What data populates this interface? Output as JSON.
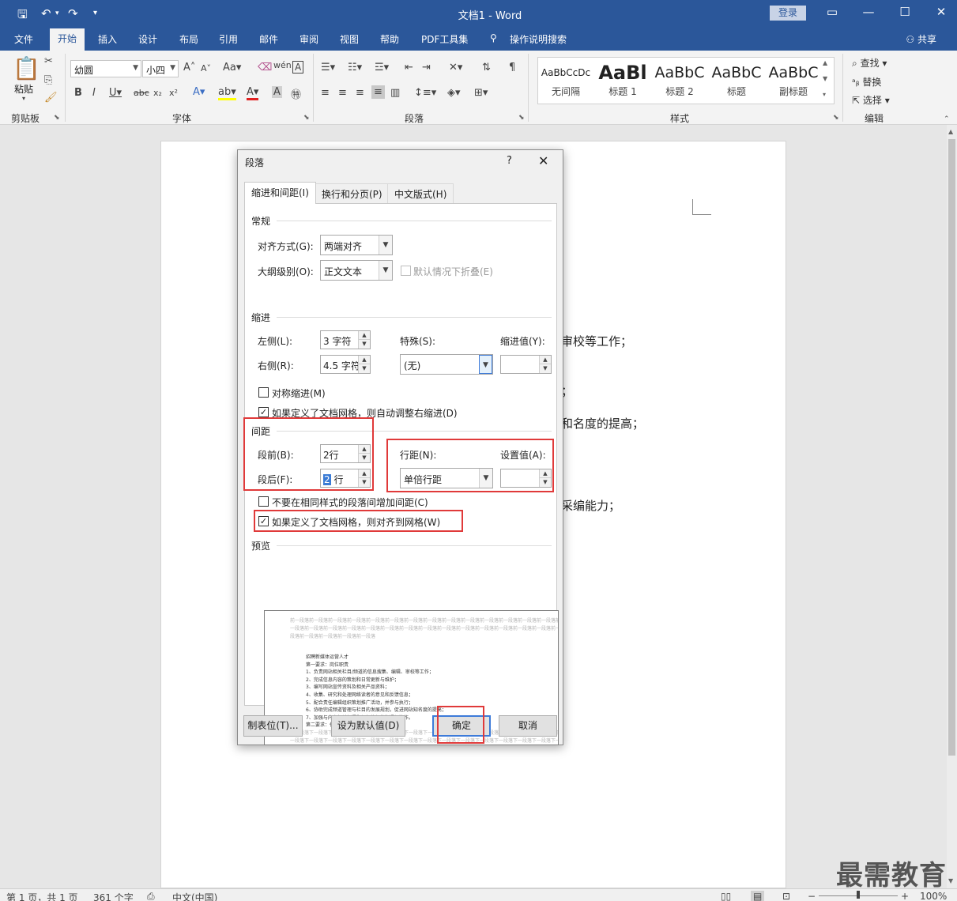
{
  "app": {
    "doc_title": "文档1 - Word",
    "login": "登录",
    "share": "共享",
    "search_tab": "操作说明搜索"
  },
  "tabs": [
    "文件",
    "开始",
    "插入",
    "设计",
    "布局",
    "引用",
    "邮件",
    "审阅",
    "视图",
    "帮助",
    "PDF工具集"
  ],
  "ribbon": {
    "clipboard": {
      "paste": "粘贴",
      "label": "剪贴板"
    },
    "font": {
      "name": "幼圆",
      "size": "小四",
      "label": "字体"
    },
    "paragraph": {
      "label": "段落"
    },
    "styles": {
      "label": "样式",
      "items": [
        {
          "sample": "AaBbCcDc",
          "name": "无间隔"
        },
        {
          "sample": "AaBl",
          "name": "标题 1"
        },
        {
          "sample": "AaBbC",
          "name": "标题 2"
        },
        {
          "sample": "AaBbC",
          "name": "标题"
        },
        {
          "sample": "AaBbC",
          "name": "副标题"
        }
      ]
    },
    "editing": {
      "find": "查找",
      "replace": "替换",
      "select": "选择",
      "label": "编辑"
    }
  },
  "document": {
    "fragments": [
      "审校等工作；",
      "；",
      "和名度的提高；",
      "采编能力；"
    ]
  },
  "dialog": {
    "title": "段落",
    "help": "?",
    "tabs": [
      "缩进和间距(I)",
      "换行和分页(P)",
      "中文版式(H)"
    ],
    "general": {
      "heading": "常规",
      "alignment_label": "对齐方式(G):",
      "alignment_value": "两端对齐",
      "outline_label": "大纲级别(O):",
      "outline_value": "正文文本",
      "collapse_label": "默认情况下折叠(E)"
    },
    "indent": {
      "heading": "缩进",
      "left_label": "左侧(L):",
      "left_value": "3 字符",
      "right_label": "右侧(R):",
      "right_value": "4.5 字符",
      "special_label": "特殊(S):",
      "special_value": "(无)",
      "by_label": "缩进值(Y):",
      "by_value": "",
      "mirror_label": "对称缩进(M)",
      "auto_right_label": "如果定义了文档网格，则自动调整右缩进(D)"
    },
    "spacing": {
      "heading": "间距",
      "before_label": "段前(B):",
      "before_value": "2行",
      "after_label": "段后(F):",
      "after_value_sel": "2",
      "after_value_rest": " 行",
      "line_label": "行距(N):",
      "line_value": "单倍行距",
      "at_label": "设置值(A):",
      "at_value": "",
      "no_space_label": "不要在相同样式的段落间增加间距(C)",
      "snap_grid_label": "如果定义了文档网格，则对齐到网格(W)"
    },
    "preview": {
      "heading": "预览",
      "prev_para": [
        "前一段落前一段落前一段落前一段落前一段落前一段落前一段落前一段落前一段落前一段落前一段落前一段落前一段落前一段落前一段落前一段落前一段落",
        "一段落前一段落前一段落前一段落前一段落前一段落前一段落前一段落前一段落前一段落前一段落前一段落前一段落前一段落前一段落前一段落前一段落",
        "段落前一段落前一段落前一段落前一段落"
      ],
      "lines": [
        "招聘新媒体运营人才",
        "第一要求：岗位职责",
        "1、负责网站相关栏目/频道的信息搜集、编辑、审校等工作；",
        "2、完成信息内容的策划和日常更新与维护；",
        "3、编写网站宣传资料及相关产品资料；",
        "4、收集、研究和处理网络读者的意见和反馈信息；",
        "5、配合责任编辑组织策划推广活动，并参与执行；",
        "6、协助完成频道管理与栏目的发展规划，促进网站知名度的提高；",
        "7、加强与内容相关部门和组织外部的沟通与协作。",
        "第二要求：任职资"
      ],
      "next_para": [
        "下一段落下一段落下一段落下一段落下一段落下一段落下一段落下一段落下一段落下一段落下一段落下一段落下一段落下一段落下一段落下一段落下一段落",
        "一段落下一段落下一段落下一段落下一段落下一段落下一段落下一段落下一段落下一段落下一段落下一段落下一段落下一段落下一段落下一段落"
      ]
    },
    "buttons": {
      "tabs": "制表位(T)...",
      "set_default": "设为默认值(D)",
      "ok": "确定",
      "cancel": "取消"
    }
  },
  "status": {
    "page": "第 1 页，共 1 页",
    "words": "361 个字",
    "lang": "中文(中国)",
    "zoom": "100%"
  },
  "watermark": "最需教育"
}
